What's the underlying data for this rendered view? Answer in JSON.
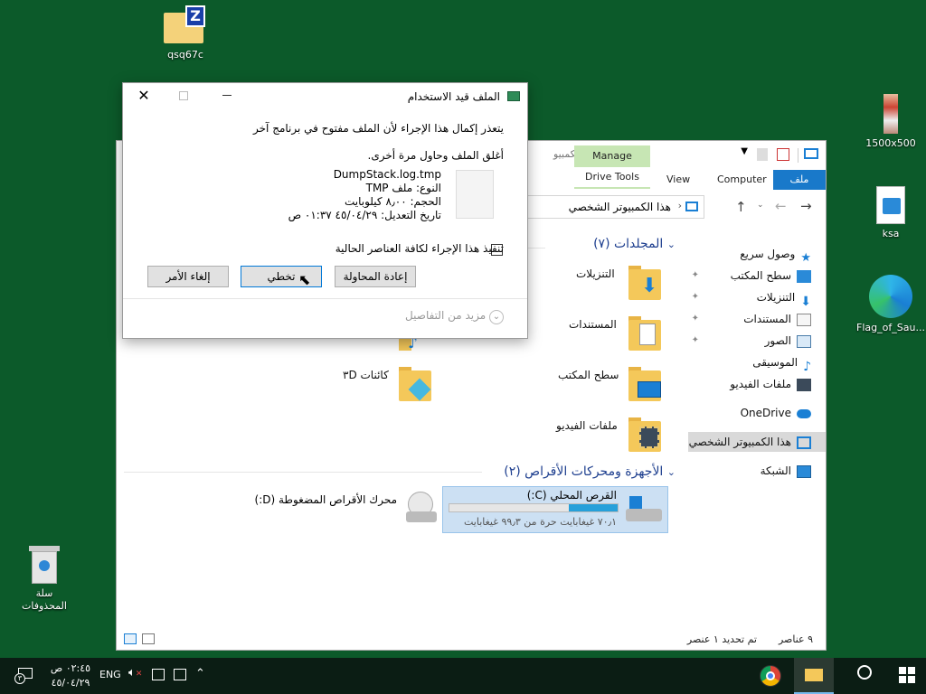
{
  "desktop": {
    "icons": [
      {
        "label": "qsq67c"
      },
      {
        "label": "1500x500"
      },
      {
        "label": "ksa"
      },
      {
        "label": "Flag_of_Sau..."
      },
      {
        "label": "سلة المحذوفات"
      }
    ]
  },
  "explorer": {
    "ribbon": {
      "file_tab": "ملف",
      "computer_tab": "Computer",
      "view_tab": "View",
      "manage_label": "Manage",
      "drive_tools_tab": "Drive Tools",
      "partial_title": "هذا الكمبيو"
    },
    "address": {
      "path": "هذا الكمبيوتر الشخصي"
    },
    "sidebar": [
      {
        "label": "وصول سريع",
        "icon": "star-icon"
      },
      {
        "label": "سطح المكتب",
        "icon": "desktop-icon",
        "pinned": true
      },
      {
        "label": "التنزيلات",
        "icon": "download-icon",
        "pinned": true
      },
      {
        "label": "المستندات",
        "icon": "documents-icon",
        "pinned": true
      },
      {
        "label": "الصور",
        "icon": "pictures-icon",
        "pinned": true
      },
      {
        "label": "الموسيقى",
        "icon": "music-icon"
      },
      {
        "label": "ملفات الفيديو",
        "icon": "video-icon"
      },
      {
        "label": "OneDrive",
        "icon": "cloud-icon"
      },
      {
        "label": "هذا الكمبيوتر الشخصي",
        "icon": "computer-icon"
      },
      {
        "label": "الشبكة",
        "icon": "network-icon"
      }
    ],
    "folders_header": "المجلدات (٧)",
    "folders": [
      {
        "label": "التنزيلات"
      },
      {
        "label": "المستندات"
      },
      {
        "label": "سطح المكتب"
      },
      {
        "label": "ملفات الفيديو"
      },
      {
        "label": "كائنات ٣D"
      }
    ],
    "devices_header": "الأجهزة ومحركات الأقراص (٢)",
    "drives": [
      {
        "label": "القرص المحلي (C:)",
        "free": "٧٠٫١ غيغابايت حرة من ٩٩٫٣ غيغابايت",
        "used_fraction": 0.29
      },
      {
        "label": "محرك الأقراص المضغوطة (D:)"
      }
    ],
    "status": {
      "items": "٩ عناصر",
      "selected": "تم تحديد ١ عنصر"
    }
  },
  "dialog": {
    "title": "الملف قيد الاستخدام",
    "message": "يتعذر إكمال هذا الإجراء لأن الملف مفتوح في برنامج آخر",
    "hint": "أغلق الملف وحاول مرة أخرى.",
    "file": {
      "name": "DumpStack.log.tmp",
      "type": "النوع: ملف TMP",
      "size": "الحجم: ٨٫٠٠ كيلوبايت",
      "modified": "تاريخ التعديل: ٤٥/٠٤/٢٩ ٠١:٣٧ ص"
    },
    "checkbox_label": "تنفيذ هذا الإجراء لكافة العناصر الحالية",
    "buttons": {
      "retry": "إعادة المحاولة",
      "skip": "تخطي",
      "cancel": "إلغاء الأمر"
    },
    "more_details": "مزيد من التفاصيل"
  },
  "taskbar": {
    "time": "٠٢:٤٥ ص",
    "date": "٤٥/٠٤/٢٩",
    "language": "ENG",
    "notifications": "٣"
  },
  "colors": {
    "desktop": "#0c5a2a",
    "accent": "#1979ca",
    "manage": "#c7e6b4"
  }
}
